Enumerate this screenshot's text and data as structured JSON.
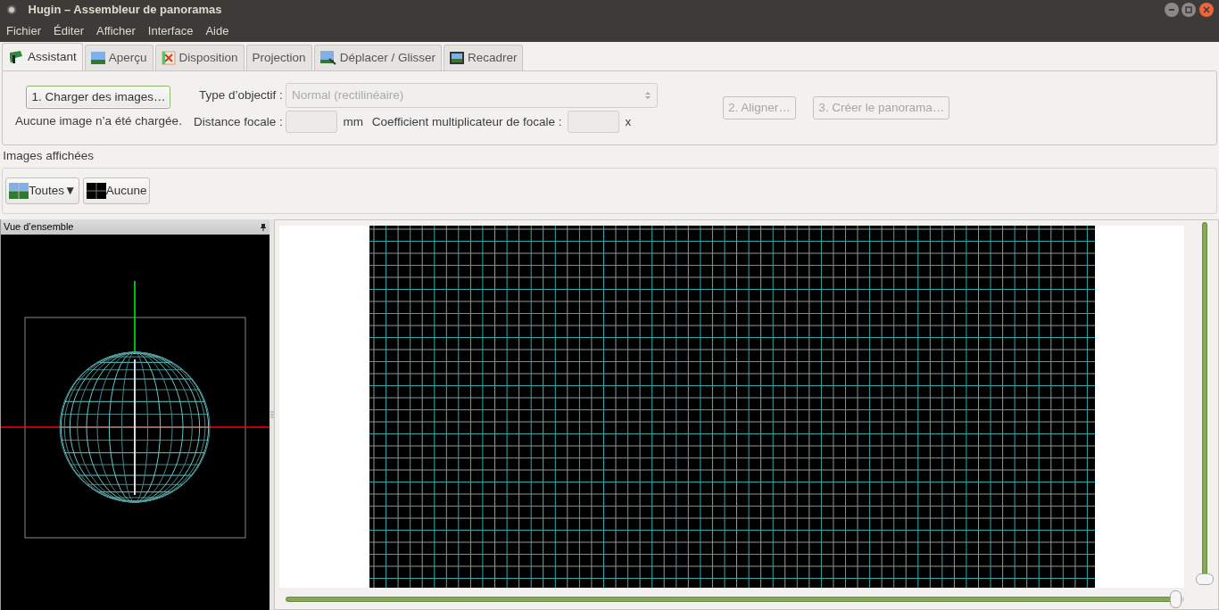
{
  "window": {
    "title": "Hugin – Assembleur de panoramas"
  },
  "menu": [
    "Fichier",
    "Éditer",
    "Afficher",
    "Interface",
    "Aide"
  ],
  "tabs": [
    {
      "label": "Assistant",
      "selected": true
    },
    {
      "label": "Aperçu",
      "selected": false
    },
    {
      "label": "Disposition",
      "selected": false
    },
    {
      "label": "Projection",
      "selected": false
    },
    {
      "label": "Déplacer / Glisser",
      "selected": false
    },
    {
      "label": "Recadrer",
      "selected": false
    }
  ],
  "assistant": {
    "load_button": {
      "label": "1. Charger des images…",
      "disabled": false
    },
    "status": "Aucune image n’a été chargée.",
    "lens_type_label": "Type d’objectif :",
    "lens_type": {
      "value": "Normal (rectilinéaire)",
      "disabled": true
    },
    "focal_label": "Distance focale :",
    "focal_unit": "mm",
    "crop_label": "Coefficient multiplicateur de focale :",
    "crop_unit": "x",
    "align_button": {
      "label": "2. Aligner…",
      "disabled": true
    },
    "create_button": {
      "label": "3. Créer le panorama…",
      "disabled": true
    }
  },
  "displayed_images": {
    "title": "Images affichées",
    "buttons": [
      {
        "label": "Toutes▼"
      },
      {
        "label": "Aucune"
      }
    ]
  },
  "overview": {
    "title": "Vue d’ensemble"
  },
  "preview": {
    "vertical_slider": {
      "level": 1
    },
    "horizontal_slider": {
      "level": 0.99
    }
  }
}
